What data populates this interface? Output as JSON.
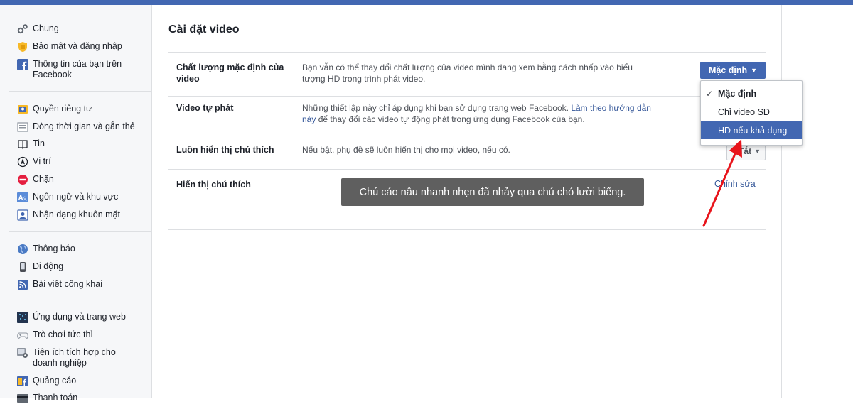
{
  "sidebar": {
    "group1": [
      {
        "label": "Chung",
        "icon": "gears-icon"
      },
      {
        "label": "Bảo mật và đăng nhập",
        "icon": "shield-icon"
      },
      {
        "label": "Thông tin của bạn trên",
        "label2": "Facebook",
        "icon": "facebook-icon"
      }
    ],
    "group2": [
      {
        "label": "Quyền riêng tư",
        "icon": "lock-icon"
      },
      {
        "label": "Dòng thời gian và gắn thẻ",
        "icon": "timeline-icon"
      },
      {
        "label": "Tin",
        "icon": "book-icon"
      },
      {
        "label": "Vị trí",
        "icon": "location-icon"
      },
      {
        "label": "Chặn",
        "icon": "block-icon"
      },
      {
        "label": "Ngôn ngữ và khu vực",
        "icon": "language-icon"
      },
      {
        "label": "Nhận dạng khuôn mặt",
        "icon": "face-recognition-icon"
      }
    ],
    "group3": [
      {
        "label": "Thông báo",
        "icon": "globe-icon"
      },
      {
        "label": "Di động",
        "icon": "mobile-icon"
      },
      {
        "label": "Bài viết công khai",
        "icon": "rss-icon"
      }
    ],
    "group4": [
      {
        "label": "Ứng dụng và trang web",
        "icon": "apps-icon"
      },
      {
        "label": "Trò chơi tức thì",
        "icon": "gamepad-icon"
      },
      {
        "label": "Tiện ích tích hợp cho",
        "label2": "doanh nghiệp",
        "icon": "business-integration-icon"
      },
      {
        "label": "Quảng cáo",
        "icon": "ads-icon"
      },
      {
        "label": "Thanh toán",
        "icon": "payment-icon"
      }
    ]
  },
  "main": {
    "title": "Cài đặt video",
    "rows": [
      {
        "label_line1": "Chất lượng mặc định của",
        "label_line2": "video",
        "desc_line1": "Bạn vẫn có thể thay đổi chất lượng của video mình đang xem bằng cách nhấp vào biểu",
        "desc_line2": "tượng HD trong trình phát video.",
        "button": "Mặc định"
      },
      {
        "label_line1": "Video tự phát",
        "desc_line1_prefix": "Những thiết lập này chỉ áp dụng khi bạn sử dụng trang web Facebook. ",
        "desc_line1_link": "Làm theo hướng dẫn",
        "desc_line2_link": "này",
        "desc_line2_suffix": " để thay đổi các video tự động phát trong ứng dụng Facebook của bạn."
      },
      {
        "label_line1": "Luôn hiển thị chú thích",
        "desc_line1": "Nếu bật, phụ đề sẽ luôn hiển thị cho mọi video, nếu có.",
        "button": "Tắt"
      },
      {
        "label_line1": "Hiển thị chú thích",
        "caption_preview": "Chú cáo nâu nhanh nhẹn đã nhảy qua chú chó lười biếng.",
        "edit_link": "Chỉnh sửa"
      }
    ],
    "dropdown": {
      "options": [
        {
          "label": "Mặc định",
          "checked": true,
          "highlighted": false
        },
        {
          "label": "Chỉ video SD",
          "checked": false,
          "highlighted": false
        },
        {
          "label": "HD nếu khả dụng",
          "checked": false,
          "highlighted": true
        }
      ],
      "check_glyph": "✓"
    }
  },
  "colors": {
    "brand": "#4267b2",
    "link": "#365899",
    "annotation_arrow": "#e8141b"
  }
}
